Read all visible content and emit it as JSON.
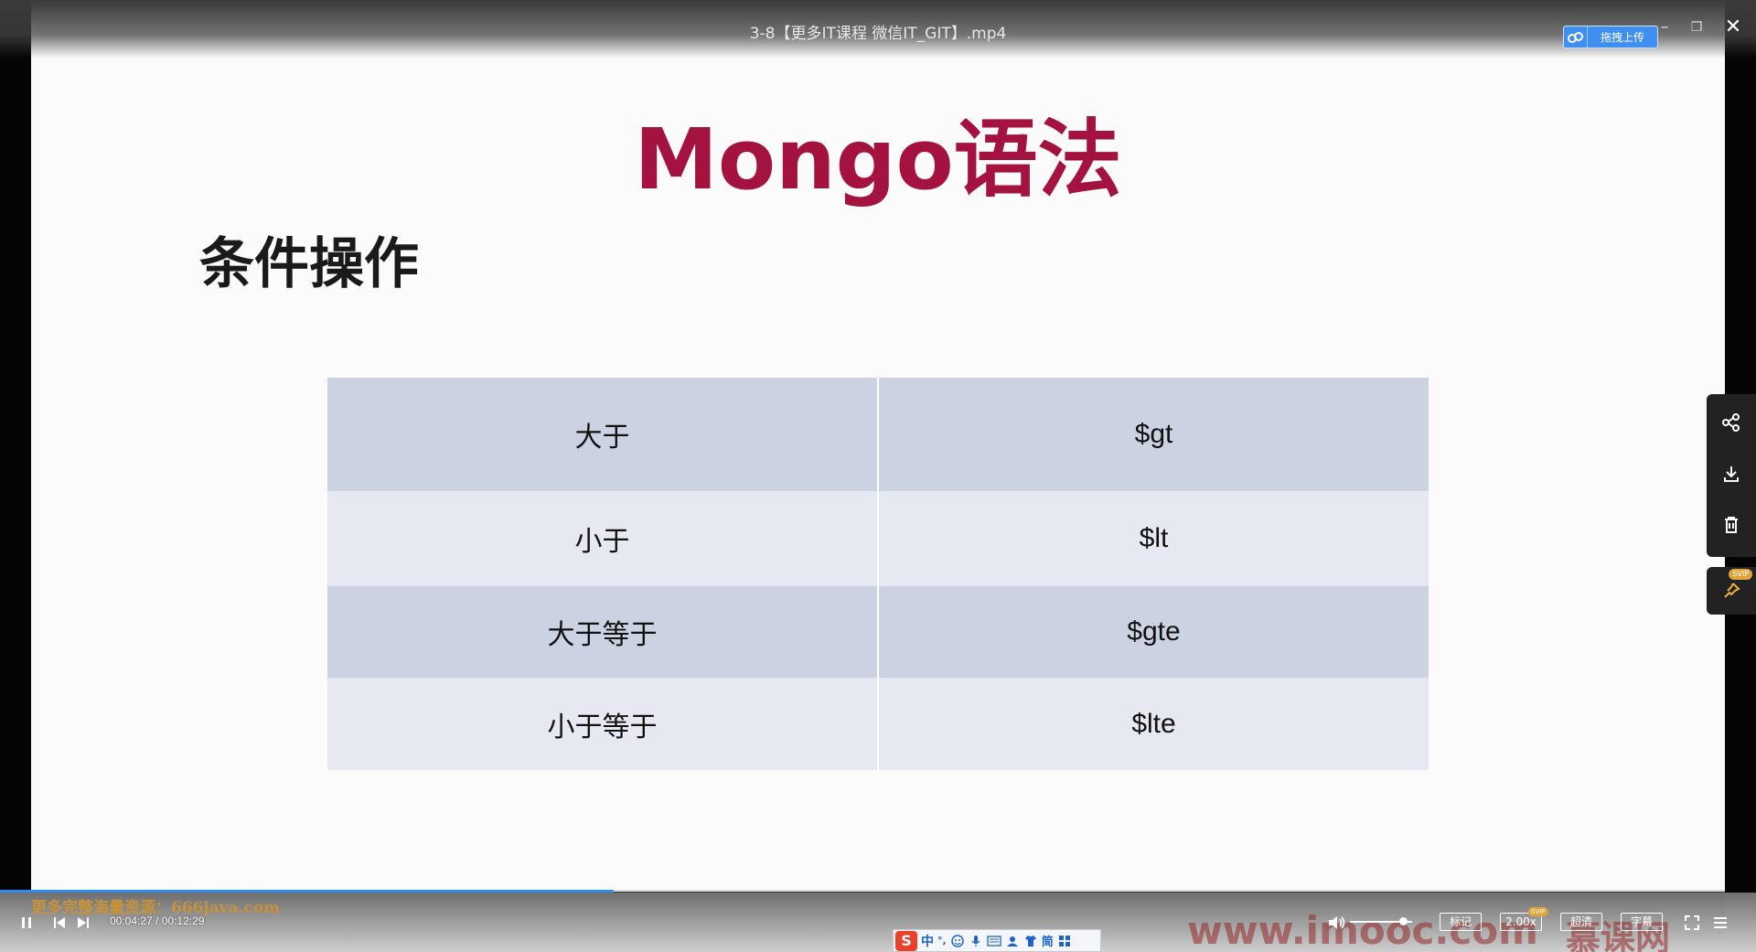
{
  "window": {
    "title": "3-8【更多IT课程 微信IT_GIT】.mp4",
    "upload_label": "拖拽上传",
    "minimize_glyph": "–",
    "restore_glyph": "❐",
    "close_glyph": "✕"
  },
  "slide": {
    "title": "Mongo语法",
    "section": "条件操作",
    "table": [
      {
        "name": "大于",
        "operator": "$gt"
      },
      {
        "name": "小于",
        "operator": "$lt"
      },
      {
        "name": "大于等于",
        "operator": "$gte"
      },
      {
        "name": "小于等于",
        "operator": "$lte"
      }
    ]
  },
  "side_panel": {
    "icons": [
      "share-icon",
      "download-icon",
      "delete-icon"
    ],
    "pin_icon": "pin-icon",
    "pin_badge": "SVIP"
  },
  "player": {
    "progress_fraction": 0.356,
    "watermark": "更多完整海量资源：666java.com",
    "time": "00:04:27 / 00:12:29",
    "site_watermark": "www.imooc.com",
    "site_watermark_2": "慕课网",
    "volume_fraction": 0.85,
    "buttons": {
      "mark": "标记",
      "speed": "2.00x",
      "speed_badge": "SVIP",
      "quality": "超清",
      "subtitle": "字幕"
    },
    "accent_color": "#2d8cf0"
  },
  "ime": {
    "logo": "S",
    "mode": "中",
    "punct": "°,",
    "script": "简"
  }
}
